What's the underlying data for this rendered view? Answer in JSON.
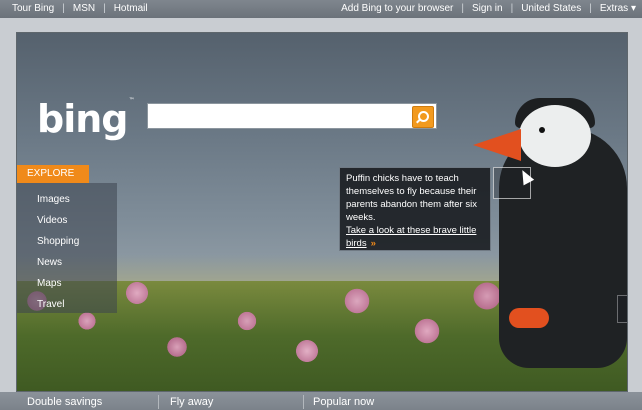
{
  "topbar": {
    "left_links": [
      "Tour Bing",
      "MSN",
      "Hotmail"
    ],
    "right_links": [
      "Add Bing to your browser",
      "Sign in",
      "United States",
      "Extras"
    ],
    "extras_chevron": "▾"
  },
  "logo": {
    "text": "bing",
    "tm": "™"
  },
  "search": {
    "value": "",
    "placeholder": ""
  },
  "explore": {
    "label": "EXPLORE",
    "items": [
      "Images",
      "Videos",
      "Shopping",
      "News",
      "Maps",
      "Travel"
    ]
  },
  "hotspot": {
    "text": "Puffin chicks have to teach themselves to fly because their parents abandon them after six weeks.",
    "link_text": "Take a look at these brave little birds",
    "arrow": "»"
  },
  "image_nav": {
    "prev": "◀",
    "next": "▶",
    "copyright": "©"
  },
  "bottombar": {
    "items": [
      "Double savings",
      "Fly away",
      "Popular now"
    ]
  }
}
